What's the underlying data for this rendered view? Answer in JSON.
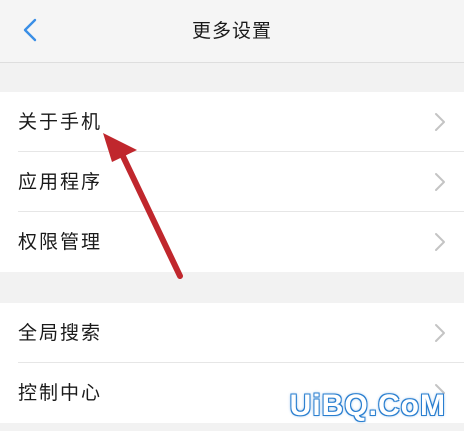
{
  "header": {
    "title": "更多设置",
    "back_icon": "chevron-left-icon"
  },
  "groups": [
    {
      "items": [
        {
          "label": "关于手机",
          "icon": "chevron-right-icon"
        },
        {
          "label": "应用程序",
          "icon": "chevron-right-icon"
        },
        {
          "label": "权限管理",
          "icon": "chevron-right-icon"
        }
      ]
    },
    {
      "items": [
        {
          "label": "全局搜索",
          "icon": "chevron-right-icon"
        },
        {
          "label": "控制中心",
          "icon": "chevron-right-icon"
        }
      ]
    }
  ],
  "colors": {
    "accent": "#3a8ee6",
    "annotation_arrow": "#c0272d",
    "chevron": "#c4c4c4"
  },
  "watermark": "UiBQ.CoM"
}
